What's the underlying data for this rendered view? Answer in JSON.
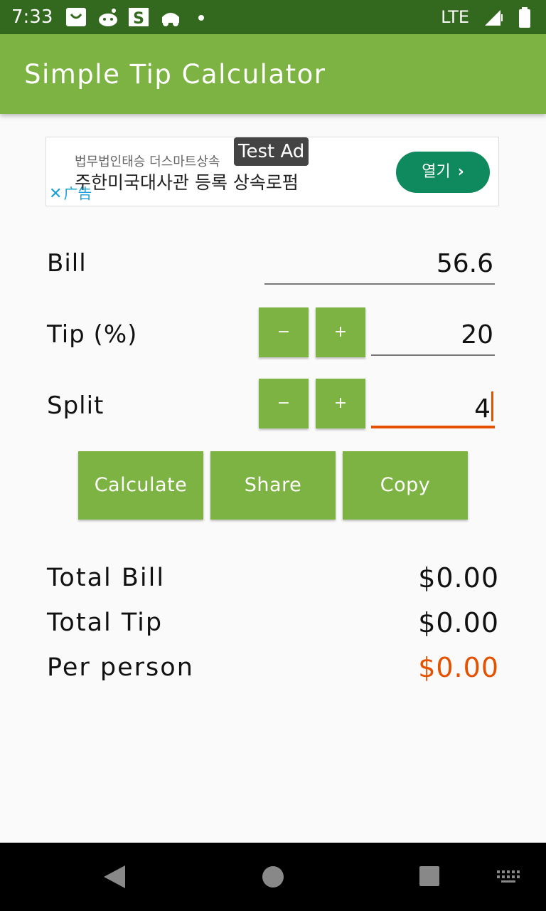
{
  "status_bar": {
    "time": "7:33",
    "network": "LTE",
    "icons": [
      "shopping-bag-icon",
      "reddit-icon",
      "s-app-icon",
      "robot-icon",
      "dot-icon"
    ]
  },
  "app": {
    "title": "Simple Tip Calculator",
    "accent_color": "#7cb342",
    "status_color": "#33691e",
    "highlight_color": "#e65100"
  },
  "ad": {
    "tag": "Test Ad",
    "line1": "법무법인태승 더스마트상속",
    "line2": "주한미국대사관 등록 상속로펌",
    "label": "广告",
    "open_button": "열기"
  },
  "form": {
    "bill_label": "Bill",
    "bill_value": "56.6",
    "tip_label": "Tip (%)",
    "tip_value": "20",
    "split_label": "Split",
    "split_value": "4",
    "minus": "−",
    "plus": "+"
  },
  "actions": {
    "calculate": "Calculate",
    "share": "Share",
    "copy": "Copy"
  },
  "results": {
    "total_bill_label": "Total Bill",
    "total_bill_value": "$0.00",
    "total_tip_label": "Total Tip",
    "total_tip_value": "$0.00",
    "per_person_label": "Per person",
    "per_person_value": "$0.00"
  }
}
